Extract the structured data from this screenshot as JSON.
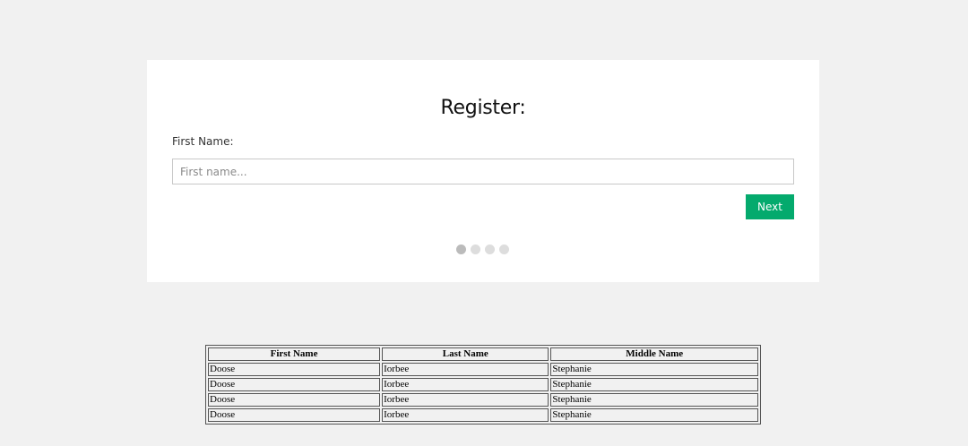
{
  "form": {
    "title": "Register:",
    "first_name_label": "First Name:",
    "first_name_placeholder": "First name...",
    "first_name_value": "",
    "next_label": "Next",
    "accent_color": "#04aa6d",
    "steps": {
      "total": 4,
      "current": 1
    }
  },
  "table": {
    "headers": [
      "First Name",
      "Last Name",
      "Middle Name"
    ],
    "rows": [
      [
        "Doose",
        "Iorbee",
        "Stephanie"
      ],
      [
        "Doose",
        "Iorbee",
        "Stephanie"
      ],
      [
        "Doose",
        "Iorbee",
        "Stephanie"
      ],
      [
        "Doose",
        "Iorbee",
        "Stephanie"
      ]
    ]
  }
}
